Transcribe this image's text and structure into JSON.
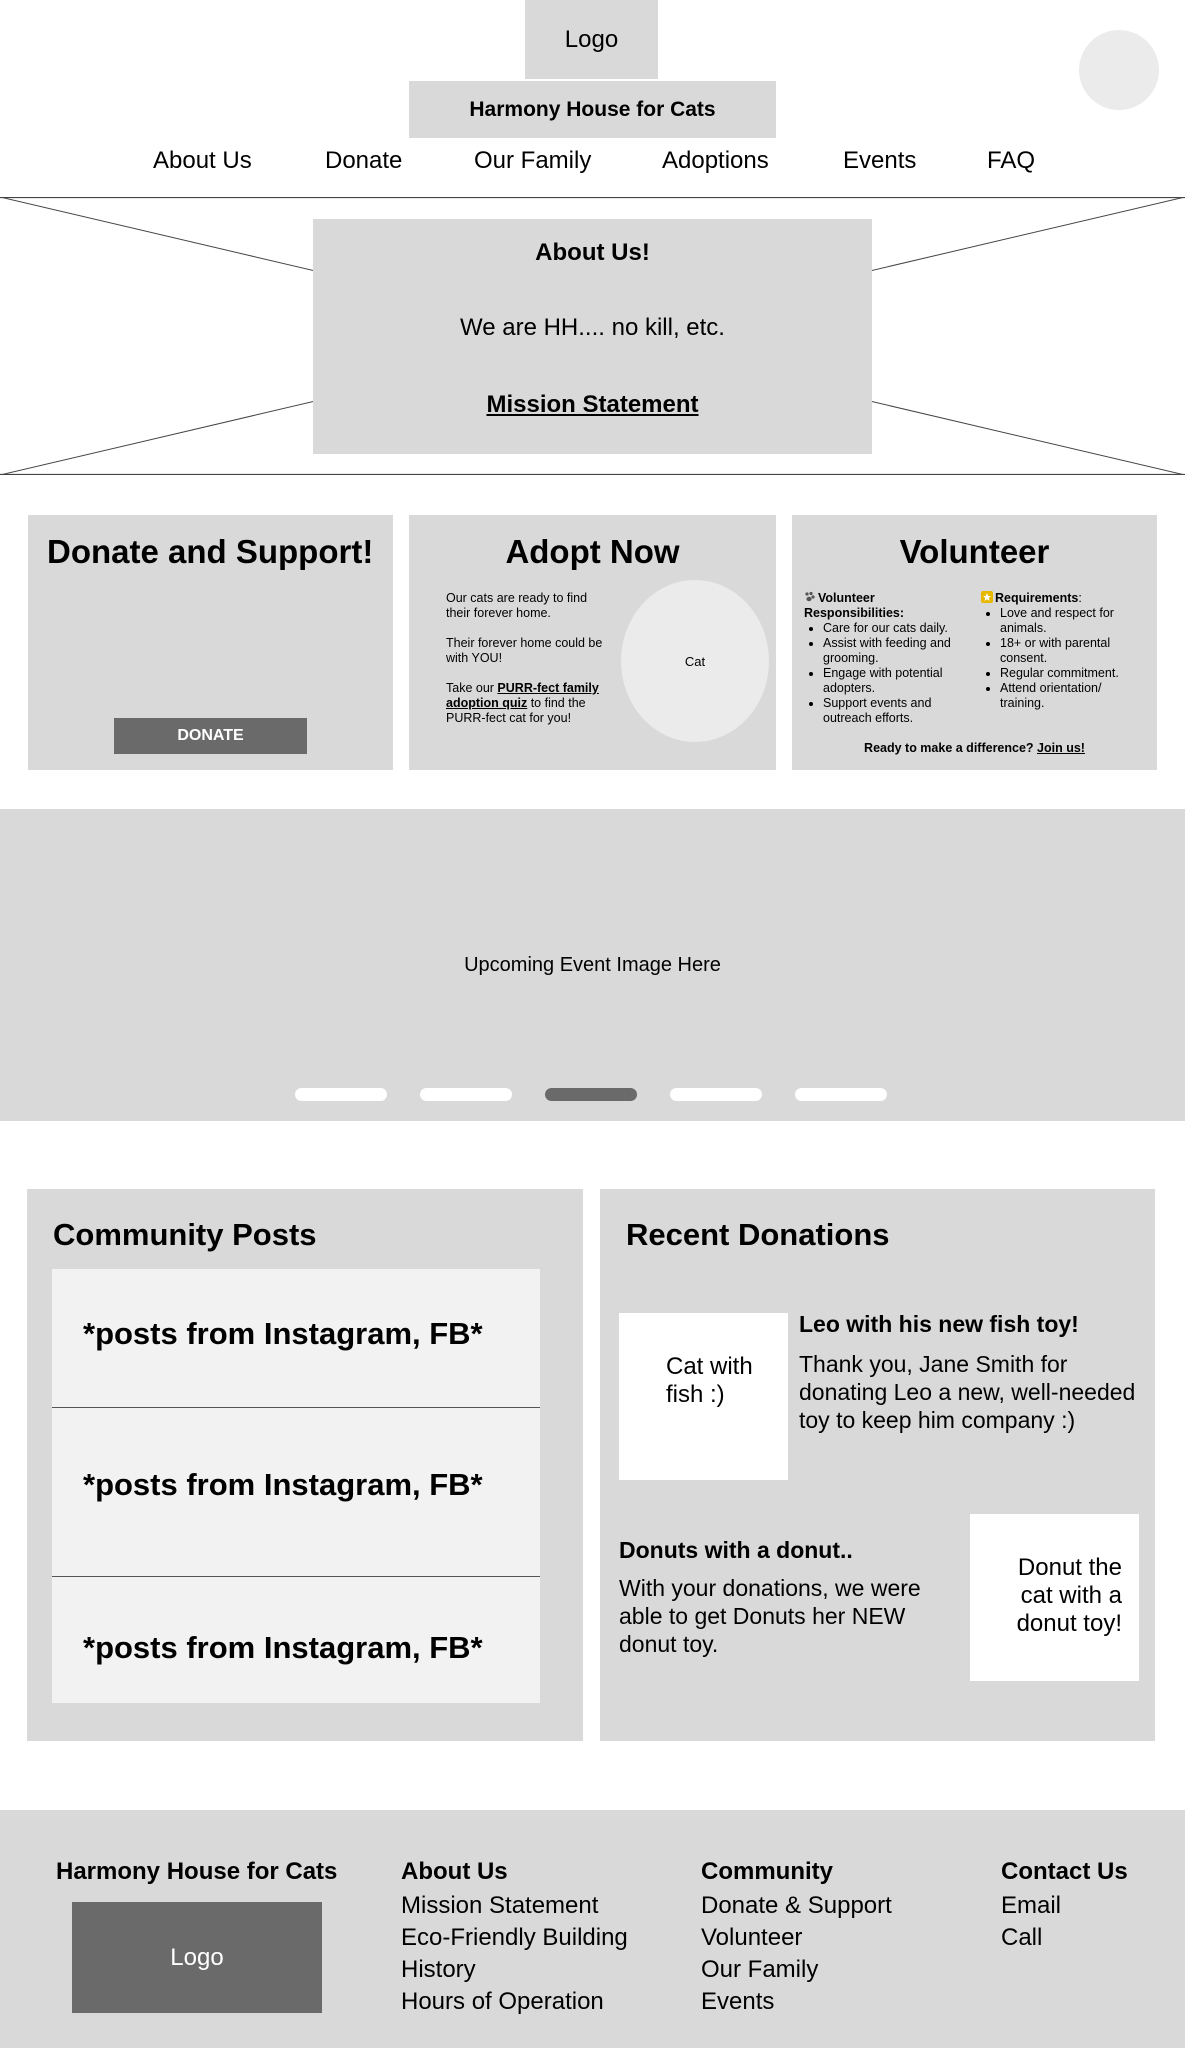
{
  "header": {
    "logo": "Logo",
    "site_title": "Harmony House for Cats",
    "nav": [
      "About Us",
      "Donate",
      "Our Family",
      "Adoptions",
      "Events",
      "FAQ"
    ]
  },
  "hero": {
    "title": "About Us!",
    "text": "We are HH.... no kill, etc.",
    "link": "Mission Statement"
  },
  "donate_card": {
    "title": "Donate and Support!",
    "button": "DONATE"
  },
  "adopt_card": {
    "title": "Adopt Now",
    "p1": "Our cats are ready to find their forever home.",
    "p2": "Their forever home could be with YOU!",
    "p3_pre": "Take our ",
    "p3_link": "PURR-fect family adoption quiz",
    "p3_post": " to find the PURR-fect cat for you!",
    "image_label": "Cat"
  },
  "volunteer_card": {
    "title": "Volunteer",
    "resp_title": "Volunteer Responsibilities:",
    "responsibilities": [
      "Care for our cats daily.",
      "Assist with feeding and grooming.",
      "Engage with potential adopters.",
      "Support events and outreach efforts."
    ],
    "req_title": "Requirements",
    "requirements": [
      "Love and respect for animals.",
      "18+ or with parental consent.",
      "Regular commitment.",
      "Attend orientation/ training."
    ],
    "cta_text": "Ready to make a difference? ",
    "cta_link": "Join us!"
  },
  "events": {
    "image_text": "Upcoming Event Image Here",
    "slide_count": 5,
    "active_slide": 3
  },
  "community": {
    "title": "Community Posts",
    "posts": [
      "*posts from Instagram, FB*",
      "*posts from Instagram, FB*",
      "*posts from Instagram, FB*"
    ]
  },
  "donations": {
    "title": "Recent Donations",
    "items": [
      {
        "image_label": "Cat with fish :)",
        "title": "Leo with his new fish toy!",
        "text": "Thank you, Jane Smith for donating Leo a new, well-needed toy to keep him company :)"
      },
      {
        "image_label": "Donut the cat with a donut toy!",
        "title": "Donuts with a donut..",
        "text": "With your donations, we were able to get Donuts her NEW donut toy."
      }
    ]
  },
  "footer": {
    "brand": "Harmony House for Cats",
    "logo": "Logo",
    "about_title": "About Us",
    "about_links": [
      "Mission Statement",
      "Eco-Friendly Building",
      "History",
      "Hours of Operation"
    ],
    "community_title": "Community",
    "community_links": [
      "Donate & Support",
      "Volunteer",
      "Our Family",
      "Events"
    ],
    "contact_title": "Contact Us",
    "contact_links": [
      "Email",
      "Call"
    ]
  }
}
